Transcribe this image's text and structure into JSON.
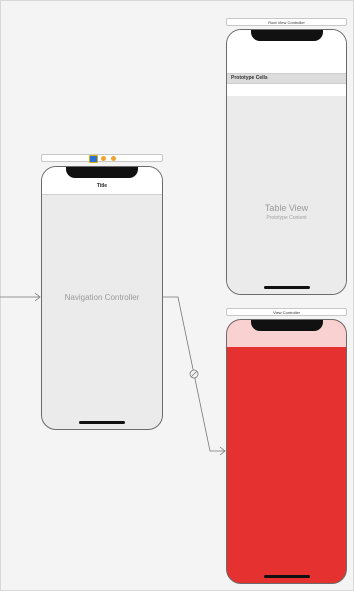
{
  "navigation_controller": {
    "nav_bar_title": "Title",
    "center_label": "Navigation Controller"
  },
  "root_view_controller": {
    "scene_title": "Root View Controller",
    "section_header": "Prototype Cells",
    "table_label": "Table View",
    "table_sublabel": "Prototype Content"
  },
  "view_controller": {
    "scene_title": "View Controller",
    "background_color": "#e63131",
    "nav_area_color": "#f9d1d1"
  },
  "colors": {
    "canvas": "#f4f4f4",
    "scene_fill": "#ebebeb",
    "segue_line": "#777777"
  },
  "dock_icons": [
    "storyboard-scene-icon",
    "first-responder-icon",
    "exit-icon"
  ]
}
